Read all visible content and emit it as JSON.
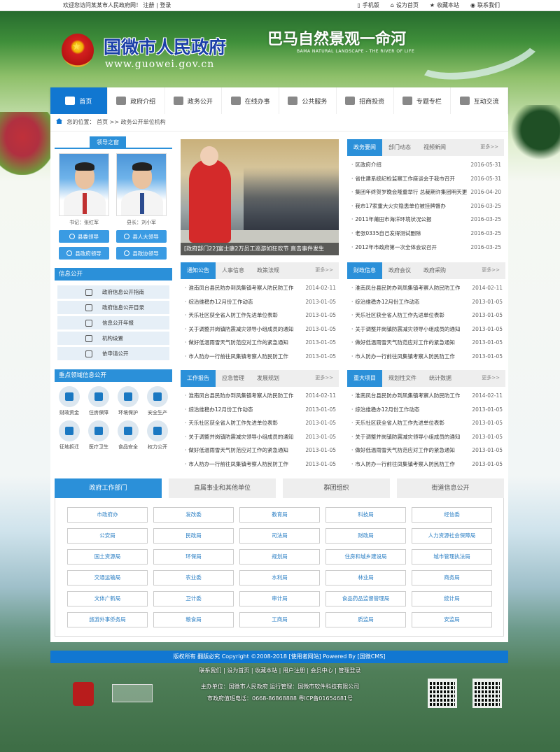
{
  "topbar": {
    "welcome": "欢迎您访问某某市人民政府网！",
    "register": "注册",
    "sep": "|",
    "login": "登录",
    "mobile": "手机版",
    "set_home": "设为首页",
    "favorite": "收藏本站",
    "contact": "联系我们"
  },
  "header": {
    "title": "国微市人民政府",
    "url": "www.guowei.gov.cn",
    "slogan": "巴马自然景观一命河",
    "slogan_sub": "BAMA NATURAL LANDSCAPE - THE RIVER OF LIFE"
  },
  "nav": [
    {
      "label": "首页",
      "icon": "home-icon"
    },
    {
      "label": "政府介绍",
      "icon": "building-icon"
    },
    {
      "label": "政务公开",
      "icon": "document-icon"
    },
    {
      "label": "在线办事",
      "icon": "chat-icon"
    },
    {
      "label": "公共服务",
      "icon": "chart-icon"
    },
    {
      "label": "招商投资",
      "icon": "money-icon"
    },
    {
      "label": "专题专栏",
      "icon": "star-icon"
    },
    {
      "label": "互动交流",
      "icon": "people-icon"
    }
  ],
  "breadcrumb": {
    "prefix": "您的位置：",
    "home": "首页",
    "sep": ">>",
    "current": "政务公开单位机构"
  },
  "leaders": {
    "title": "领导之窗",
    "people": [
      {
        "caption": "书记：张红军"
      },
      {
        "caption": "县长：刘小军"
      }
    ],
    "buttons": [
      "县委领导",
      "县人大领导",
      "县政府领导",
      "县政协领导"
    ]
  },
  "info_open": {
    "title": "信息公开",
    "items": [
      "政府信息公开指南",
      "政府信息公开目录",
      "信息公开年报",
      "机构设置",
      "依申请公开"
    ]
  },
  "key_fields": {
    "title": "重点领域信息公开",
    "items": [
      "财政资金",
      "住房保障",
      "环境保护",
      "安全生产",
      "征地拆迁",
      "医疗卫生",
      "食品安全",
      "权力公开"
    ]
  },
  "slide": {
    "caption": "[政府部门22]富士康2万员工巡游如狂欢节 直击事件发生"
  },
  "gov_news": {
    "tabs": [
      "政务要闻",
      "部门动态",
      "视频新闻"
    ],
    "more": "更多>>",
    "rows": [
      {
        "title": "区政府介绍",
        "date": "2016-05-31"
      },
      {
        "title": "省住建系统纪检监察工作座谈会于我市召开",
        "date": "2016-05-31"
      },
      {
        "title": "集团年终贺岁晚会隆重举行 总裁期许集团明天更",
        "date": "2016-04-20"
      },
      {
        "title": "我市17家重大火灾隐患单位被挂牌督办",
        "date": "2016-03-25"
      },
      {
        "title": "2011年莆田市海洋环境状况公报",
        "date": "2016-03-25"
      },
      {
        "title": "老张0335自己发得测试删除",
        "date": "2016-03-25"
      },
      {
        "title": "2012年市政府第一次全体会议召开",
        "date": "2016-03-25"
      }
    ]
  },
  "notice": {
    "tabs": [
      "通知公告",
      "人事信息",
      "政策法规"
    ],
    "more": "更多>>",
    "rows": [
      {
        "title": "淮南凤台县民防办到凤集镇考察人防民防工作",
        "date": "2014-02-11"
      },
      {
        "title": "综治维稳办12月份工作动态",
        "date": "2013-01-05"
      },
      {
        "title": "天乐社区获全省人防工作先进单位表彰",
        "date": "2013-01-05"
      },
      {
        "title": "关于调整并岗镇防震减灾领导小组成员的通知",
        "date": "2013-01-05"
      },
      {
        "title": "做好低温雨雪天气防范应对工作的紧急通知",
        "date": "2013-01-05"
      },
      {
        "title": "市人防办一行前往凤集镇考察人防民防工作",
        "date": "2013-01-05"
      }
    ]
  },
  "finance": {
    "tabs": [
      "财政信息",
      "政府会议",
      "政府采购"
    ],
    "more": "更多>>",
    "rows": [
      {
        "title": "淮南凤台县民防办到凤集镇考察人防民防工作",
        "date": "2014-02-11"
      },
      {
        "title": "综治维稳办12月份工作动态",
        "date": "2013-01-05"
      },
      {
        "title": "天乐社区获全省人防工作先进单位表彰",
        "date": "2013-01-05"
      },
      {
        "title": "关于调整并岗镇防震减灾领导小组成员的通知",
        "date": "2013-01-05"
      },
      {
        "title": "做好低温雨雪天气防范应对工作的紧急通知",
        "date": "2013-01-05"
      },
      {
        "title": "市人防办一行前往凤集镇考察人防民防工作",
        "date": "2013-01-05"
      }
    ]
  },
  "work": {
    "tabs": [
      "工作报告",
      "应急管理",
      "发展规划"
    ],
    "more": "更多>>",
    "rows": [
      {
        "title": "淮南凤台县民防办到凤集镇考察人防民防工作",
        "date": "2014-02-11"
      },
      {
        "title": "综治维稳办12月份工作动态",
        "date": "2013-01-05"
      },
      {
        "title": "天乐社区获全省人防工作先进单位表彰",
        "date": "2013-01-05"
      },
      {
        "title": "关于调整并岗镇防震减灾领导小组成员的通知",
        "date": "2013-01-05"
      },
      {
        "title": "做好低温雨雪天气防范应对工作的紧急通知",
        "date": "2013-01-05"
      },
      {
        "title": "市人防办一行前往凤集镇考察人防民防工作",
        "date": "2013-01-05"
      }
    ]
  },
  "projects": {
    "tabs": [
      "重大项目",
      "规划性文件",
      "统计数据"
    ],
    "more": "更多>>",
    "rows": [
      {
        "title": "淮南凤台县民防办到凤集镇考察人防民防工作",
        "date": "2014-02-11"
      },
      {
        "title": "综治维稳办12月份工作动态",
        "date": "2013-01-05"
      },
      {
        "title": "天乐社区获全省人防工作先进单位表彰",
        "date": "2013-01-05"
      },
      {
        "title": "关于调整并岗镇防震减灾领导小组成员的通知",
        "date": "2013-01-05"
      },
      {
        "title": "做好低温雨雪天气防范应对工作的紧急通知",
        "date": "2013-01-05"
      },
      {
        "title": "市人防办一行前往凤集镇考察人防民防工作",
        "date": "2013-01-05"
      }
    ]
  },
  "depts": {
    "tabs": [
      "政府工作部门",
      "直属事业和其他单位",
      "群团组织",
      "街道信息公开"
    ],
    "items": [
      "市政府办",
      "发改委",
      "教育局",
      "科技局",
      "经信委",
      "公安局",
      "民政局",
      "司法局",
      "财政局",
      "人力资源社会保障局",
      "国土资源局",
      "环保局",
      "规划局",
      "住房和城乡建设局",
      "城市管理执法局",
      "交通运输局",
      "农业委",
      "水利局",
      "林业局",
      "商务局",
      "文体广新局",
      "卫计委",
      "审计局",
      "食品药品监督管理局",
      "统计局",
      "旅游外事侨务局",
      "粮食局",
      "工商局",
      "质监局",
      "安监局"
    ]
  },
  "footer": {
    "copyright": "版权所有 翻版必究 Copyright ©2008-2018 [使用者网站] Powered By [国微CMS]",
    "links": "联系我们 | 设为首页 | 收藏本站 | 用户注册 | 会员中心 | 管理登录",
    "sponsor": "主办单位：国微市人民政府 运行管理：国微市软件科技有限公司",
    "phone": "市政府值班电话：0668-86868888 粤ICP备01654681号"
  }
}
